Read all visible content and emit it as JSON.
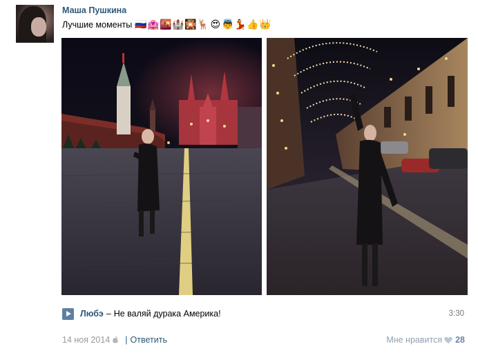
{
  "post": {
    "author": "Маша Пушкина",
    "text": "Лучшие моменты",
    "emojis": [
      {
        "icon": "russia-flag-icon",
        "glyph": "🇷🇺"
      },
      {
        "icon": "love-hotel-icon",
        "glyph": "🏩"
      },
      {
        "icon": "sunset-city-icon",
        "glyph": "🌇"
      },
      {
        "icon": "castle-icon",
        "glyph": "🏰"
      },
      {
        "icon": "fireworks-icon",
        "glyph": "🎇"
      },
      {
        "icon": "reindeer-icon",
        "glyph": "🦌"
      },
      {
        "icon": "heart-eyes-icon",
        "glyph": "😍"
      },
      {
        "icon": "angel-icon",
        "glyph": "👼"
      },
      {
        "icon": "dancer-icon",
        "glyph": "💃"
      },
      {
        "icon": "thumbs-up-icon",
        "glyph": "👍"
      },
      {
        "icon": "crown-icon",
        "glyph": "👑"
      }
    ]
  },
  "audio": {
    "artist": "Любэ",
    "separator": "–",
    "title": "Не валяй дурака Америка!",
    "duration": "3:30"
  },
  "meta": {
    "date": "14 ноя 2014",
    "separator": "|",
    "reply": "Ответить"
  },
  "likes": {
    "label": "Мне нравится",
    "count": "28"
  },
  "colors": {
    "link": "#2b587a",
    "muted": "#999999",
    "play": "#5f7fa1"
  }
}
